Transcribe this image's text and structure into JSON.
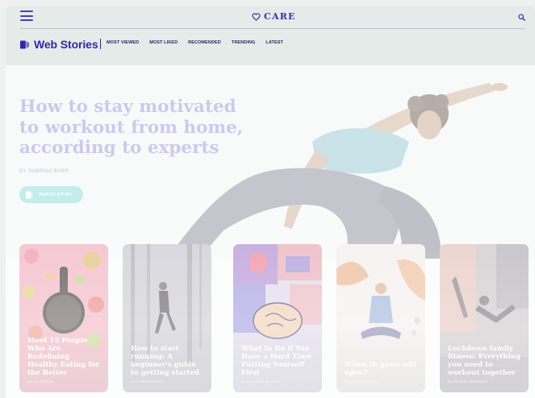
{
  "header": {
    "brand": "CARE",
    "menu_icon": "hamburger-menu-icon",
    "search_icon": "search-icon"
  },
  "subheader": {
    "title": "Web Stories",
    "nav": [
      "MOST VIEWED",
      "MOST LIKED",
      "RECOMENDED",
      "TRENDING",
      "LATEST"
    ]
  },
  "hero": {
    "title": "How to stay motivated to workout from home, according to experts",
    "author": "BY SABRINA BARR",
    "cta": "WATCH STORY"
  },
  "cards": [
    {
      "title": "Meet 15 People Who Are Redefining Healthy Eating for the Better",
      "author": "BY LIZ COWAN"
    },
    {
      "title": "How to start running: A beginner's guide to getting started",
      "author": "BY SABRINA BARR"
    },
    {
      "title": "What to Do if You Have a Hard Time Putting Yourself First",
      "author": "BY KATHRYN MURPHY"
    },
    {
      "title": "When th gyms will open?",
      "author": "BY JOHANNA CLARK"
    },
    {
      "title": "Lockdown family fitness: Everything you need to workout together",
      "author": "BY PRADSA SADIKSHA"
    }
  ],
  "colors": {
    "brand": "#3526a8",
    "header_bg": "#e5ebe9",
    "hero_title": "#cfc8ec",
    "cta_bg": "#c3eceb"
  }
}
